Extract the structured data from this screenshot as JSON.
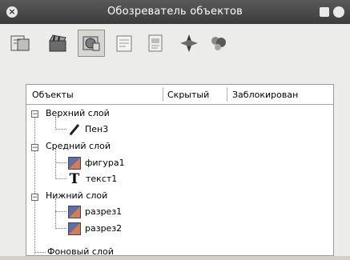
{
  "window": {
    "title": "Обозреватель объектов"
  },
  "toolbar": {
    "tools": [
      {
        "icon": "document-props-icon"
      },
      {
        "icon": "clapperboard-icon"
      },
      {
        "icon": "objects-browser-icon",
        "active": true
      },
      {
        "icon": "notes-icon"
      },
      {
        "icon": "page-icon"
      },
      {
        "icon": "navigator-icon"
      },
      {
        "icon": "layers-icon"
      }
    ]
  },
  "tree": {
    "columns": [
      "Объекты",
      "Скрытый",
      "Заблокирован"
    ],
    "rows": [
      {
        "label": "Верхний слой",
        "kind": "layer",
        "expanded": true
      },
      {
        "label": "Пен3",
        "kind": "pen"
      },
      {
        "label": "Средний слой",
        "kind": "layer",
        "expanded": true
      },
      {
        "label": "фигура1",
        "kind": "shape"
      },
      {
        "label": "текст1",
        "kind": "text"
      },
      {
        "label": "Нижний слой",
        "kind": "layer",
        "expanded": true
      },
      {
        "label": "разрез1",
        "kind": "shape"
      },
      {
        "label": "разрез2",
        "kind": "shape"
      },
      {
        "label": "Фоновый слой",
        "kind": "layer"
      }
    ]
  },
  "colors": {
    "titlebar": "#444444",
    "panel": "#ececea",
    "tree_bg": "#ffffff"
  }
}
